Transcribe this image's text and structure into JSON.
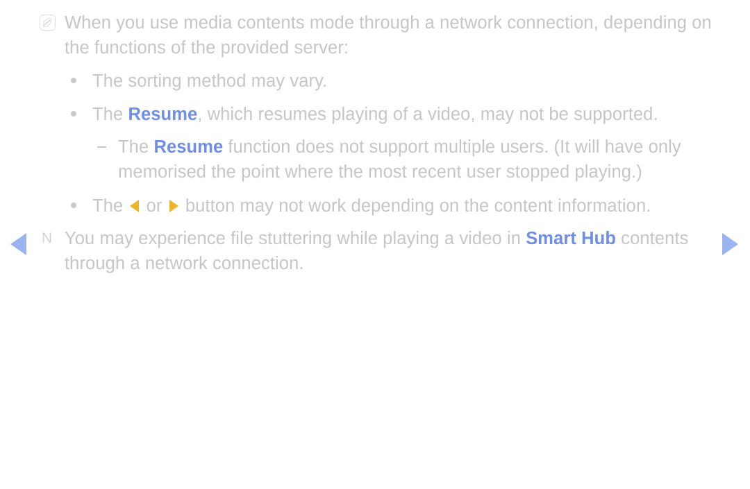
{
  "page": {
    "background_color": "#ffffff",
    "text_color": "#c6c6c6",
    "accent_blue": "#6f8ee8",
    "arrow_gold": "#eeb528",
    "nav_arrow_blue": "#9bb4f0"
  },
  "note": {
    "icon": "note-pen-icon",
    "line1": "When you use media contents mode through a network connection, depending on",
    "line2": "the functions of the provided server:"
  },
  "bullets": [
    {
      "marker": "bullet-dot",
      "text": "The sorting method may vary."
    },
    {
      "marker": "bullet-dot",
      "prefix": "The ",
      "highlight": "Resume",
      "suffix": ", which resumes playing of a video, may not be supported."
    },
    {
      "marker": "dash",
      "prefix": "The ",
      "highlight": "Resume",
      "suffix": " function does not support multiple users. (It will have only",
      "line2": "memorised the point where the most recent user stopped playing.)"
    },
    {
      "marker": "bullet-dot",
      "prefix": "The ",
      "arrow_left": "left-arrow-icon",
      "middle": " or ",
      "arrow_right": "right-arrow-icon",
      "suffix": " button may not work depending on the content information."
    }
  ],
  "footnote": {
    "marker": "N",
    "prefix": "You may experience file stuttering while playing a video in ",
    "highlight": "Smart Hub",
    "suffix": " contents",
    "line2": "through a network connection."
  },
  "navigation": {
    "prev_label": "previous-page",
    "next_label": "next-page"
  }
}
